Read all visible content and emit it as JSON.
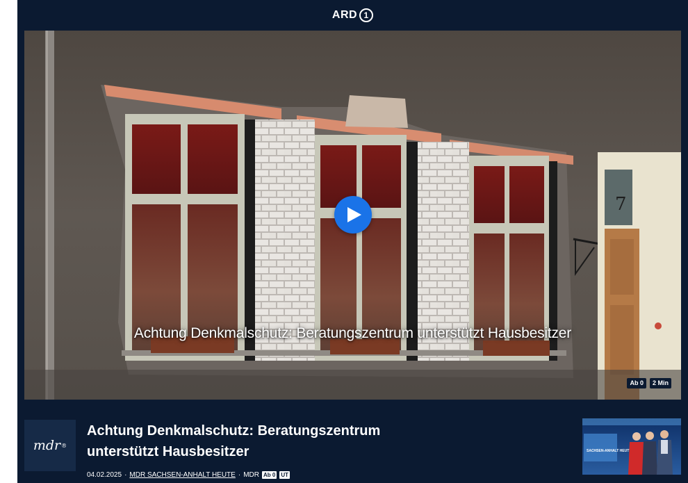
{
  "header": {
    "logo_text": "ARD",
    "logo_badge": "1"
  },
  "player": {
    "title": "Achtung Denkmalschutz: Beratungszentrum unterstützt Hausbesitzer",
    "badges": [
      "Ab 0",
      "2 Min"
    ],
    "house_number": "7",
    "play_icon": "play-icon"
  },
  "info": {
    "channel_logo": "mdr",
    "headline_line1": "Achtung Denkmalschutz: Beratungszentrum",
    "headline_line2": "unterstützt Hausbesitzer",
    "date": "04.02.2025",
    "sep1": "·",
    "show": "MDR SACHSEN-ANHALT HEUTE",
    "sep2": "·",
    "broadcaster": "MDR",
    "meta_badges": [
      "Ab 0",
      "UT"
    ],
    "thumbnail_text": "SACHSEN-ANHALT HEUTE"
  },
  "colors": {
    "background": "#0b1a31",
    "play_button": "#1a73e8"
  }
}
